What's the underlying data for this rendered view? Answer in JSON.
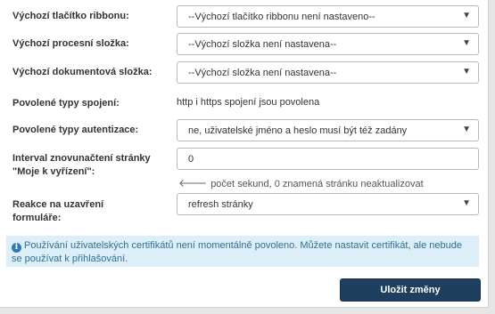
{
  "fields": {
    "ribbon_button": {
      "label": "Výchozí tlačítko ribbonu:",
      "value": "--Výchozí tlačítko ribbonu není nastaveno--"
    },
    "process_folder": {
      "label": "Výchozí procesní složka:",
      "value": "--Výchozí složka není nastavena--"
    },
    "document_folder": {
      "label": "Výchozí dokumentová složka:",
      "value": "--Výchozí složka není nastavena--"
    },
    "connection_types": {
      "label": "Povolené typy spojení:",
      "value": "http i https spojení jsou povolena"
    },
    "auth_types": {
      "label": "Povolené typy autentizace:",
      "value": "ne, uživatelské jméno a heslo musí být též zadány"
    },
    "refresh_interval": {
      "label_line1": "Interval znovunačtení stránky",
      "label_line2": "\"Moje k vyřízení\":",
      "value": "0",
      "hint": "počet sekund, 0 znamená stránku neaktualizovat"
    },
    "form_close": {
      "label_line1": "Reakce na uzavření",
      "label_line2": "formuláře:",
      "value": "refresh stránky"
    }
  },
  "info": {
    "text": "Používání uživatelských certifikátů není momentálně povoleno. Můžete nastavit certifikát, ale nebude se používat k přihlašování."
  },
  "actions": {
    "save_label": "Uložit změny"
  },
  "icons": {
    "caret": "caret-down-icon",
    "hint_arrow": "arrow-left-icon",
    "info": "info-circle-icon"
  },
  "colors": {
    "save_button": "#1e3f5e",
    "info_background": "#dceef8",
    "info_text": "#31708f"
  }
}
